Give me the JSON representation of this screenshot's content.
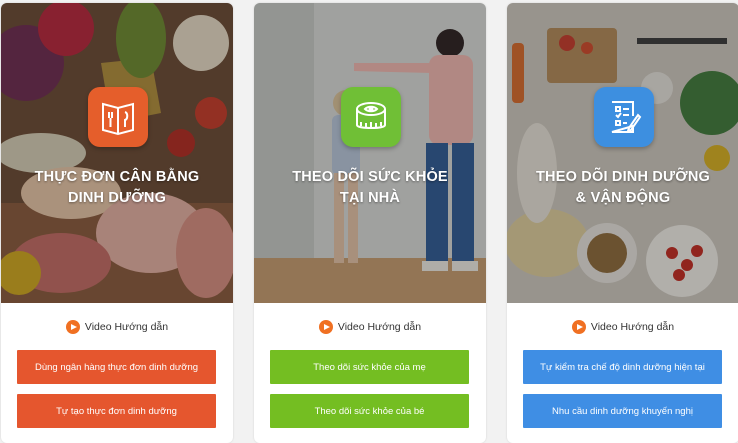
{
  "cards": [
    {
      "title_line1": "THỰC ĐƠN CÂN BẰNG",
      "title_line2": "DINH DƯỠNG",
      "icon": "menu-book-icon",
      "badge_color": "#e55e2b",
      "video_label": "Video Hướng dẫn",
      "buttons": [
        "Dùng ngân hàng thực đơn dinh dưỡng",
        "Tự tạo thực đơn dinh dưỡng"
      ],
      "button_color": "#e5562e"
    },
    {
      "title_line1": "THEO DÕI SỨC KHỎE",
      "title_line2": "TẠI NHÀ",
      "icon": "measuring-tape-icon",
      "badge_color": "#70bf36",
      "video_label": "Video Hướng dẫn",
      "buttons": [
        "Theo dõi sức khỏe của mẹ",
        "Theo dõi sức khỏe của bé"
      ],
      "button_color": "#74be22"
    },
    {
      "title_line1": "THEO DÕI DINH DƯỠNG",
      "title_line2": "& VẬN ĐỘNG",
      "icon": "checklist-icon",
      "badge_color": "#3d8fe0",
      "video_label": "Video Hướng dẫn",
      "buttons": [
        "Tự kiểm tra chế độ dinh dưỡng hiện tại",
        "Nhu cầu dinh dưỡng khuyến nghị"
      ],
      "button_color": "#3f8ee4"
    }
  ],
  "play_icon_color": "#f07022"
}
